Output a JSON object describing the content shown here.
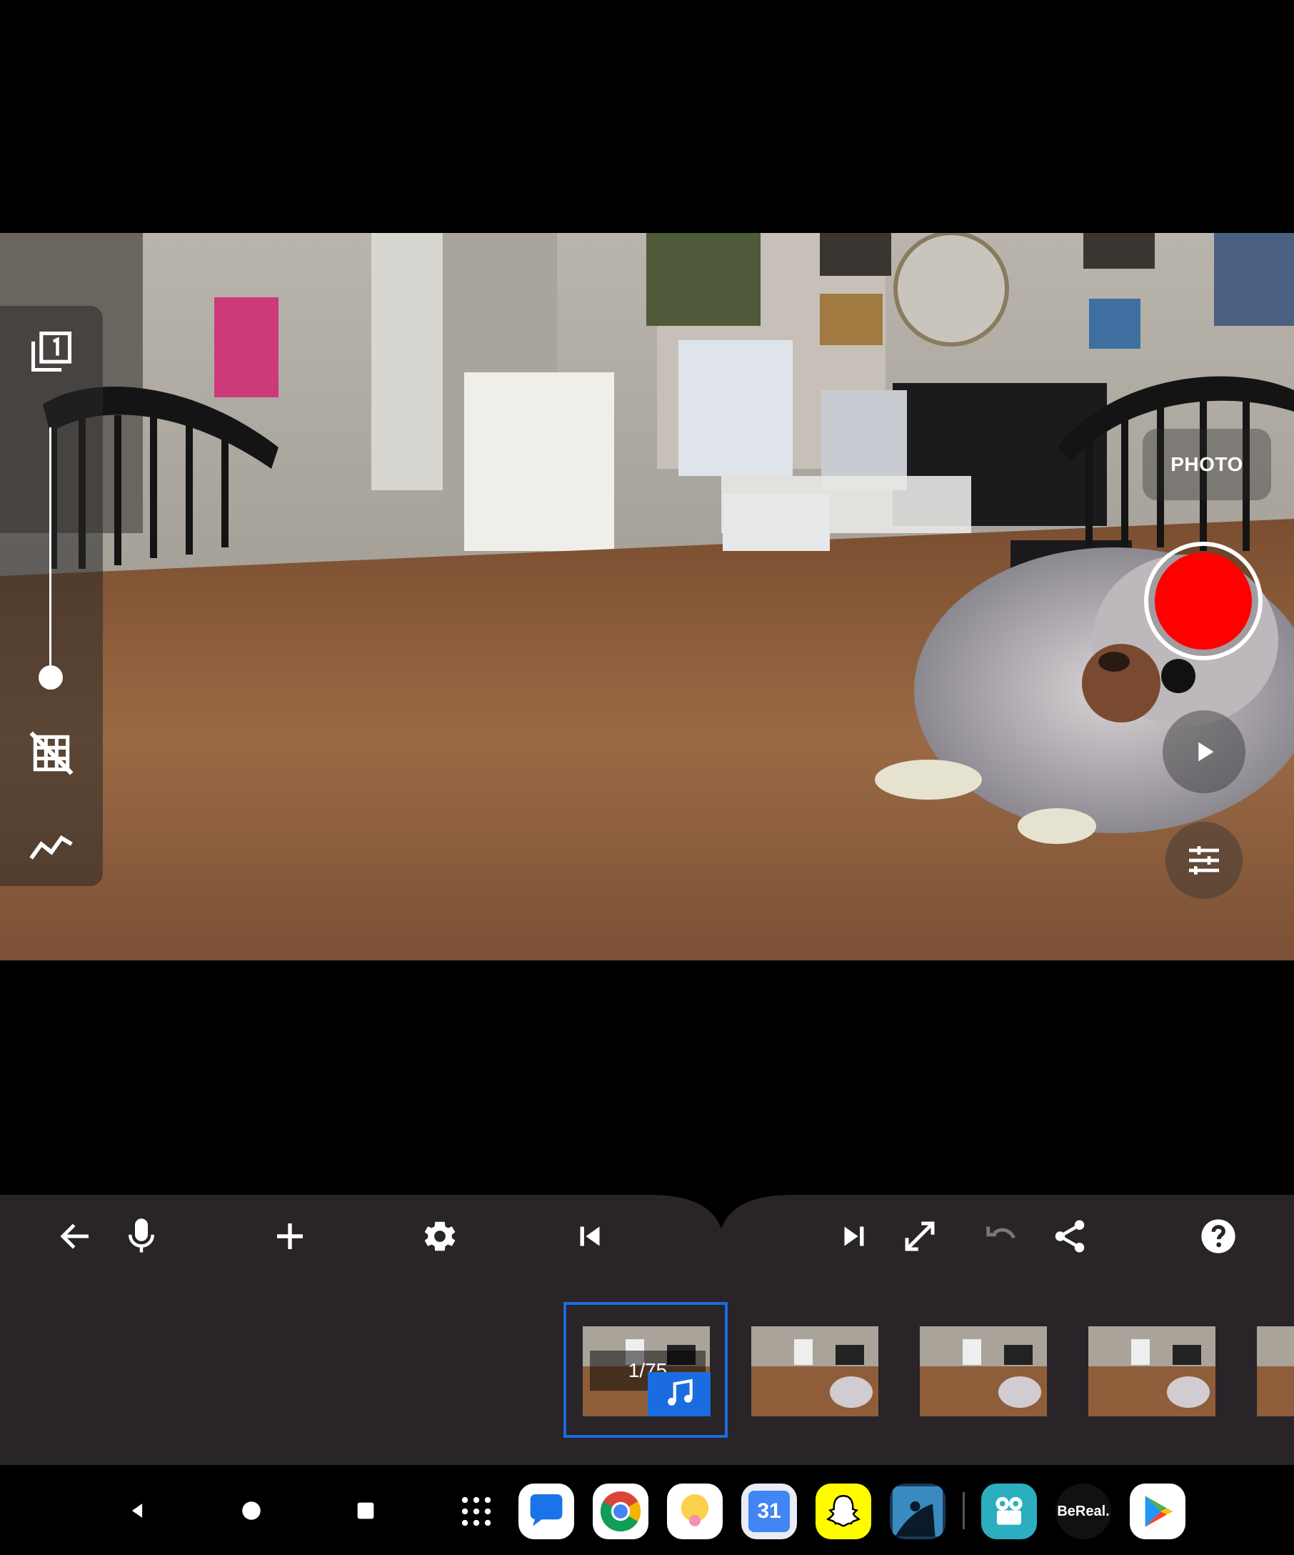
{
  "camera": {
    "mode_label": "PHOTO",
    "zoom_level": 0.0
  },
  "left_panel": {
    "icons": [
      "frame-count-icon",
      "grid-off-icon",
      "graph-icon"
    ]
  },
  "toolbar": {
    "buttons": [
      "back-arrow-icon",
      "microphone-icon",
      "add-icon",
      "settings-icon",
      "skip-previous-icon",
      "skip-next-icon",
      "expand-icon",
      "undo-icon",
      "share-icon",
      "help-icon"
    ]
  },
  "filmstrip": {
    "counter": "1/75",
    "selected_index": 0,
    "frame_count_visible": 5
  },
  "nav": {
    "buttons": [
      "back-icon",
      "home-icon",
      "recents-icon"
    ]
  },
  "dock": {
    "apps": [
      {
        "name": "app-drawer",
        "icon": "grid-dots-icon"
      },
      {
        "name": "messages",
        "icon": "messages-icon",
        "color": "#ffffff"
      },
      {
        "name": "chrome",
        "icon": "chrome-icon",
        "color": "#ffffff"
      },
      {
        "name": "keep",
        "icon": "bulb-icon",
        "color": "#ffffff"
      },
      {
        "name": "calendar",
        "icon": "calendar-icon",
        "label": "31",
        "color": "#4285f4"
      },
      {
        "name": "snapchat",
        "icon": "ghost-icon",
        "color": "#fffc00"
      },
      {
        "name": "kindle",
        "icon": "kindle-icon",
        "color": "#1a3a5a"
      },
      {
        "name": "stop-motion",
        "icon": "movie-icon",
        "color": "#2aaec0"
      },
      {
        "name": "bereal",
        "label": "BeReal.",
        "color": "#000000"
      },
      {
        "name": "play-store",
        "icon": "play-store-icon",
        "color": "#ffffff"
      }
    ]
  }
}
